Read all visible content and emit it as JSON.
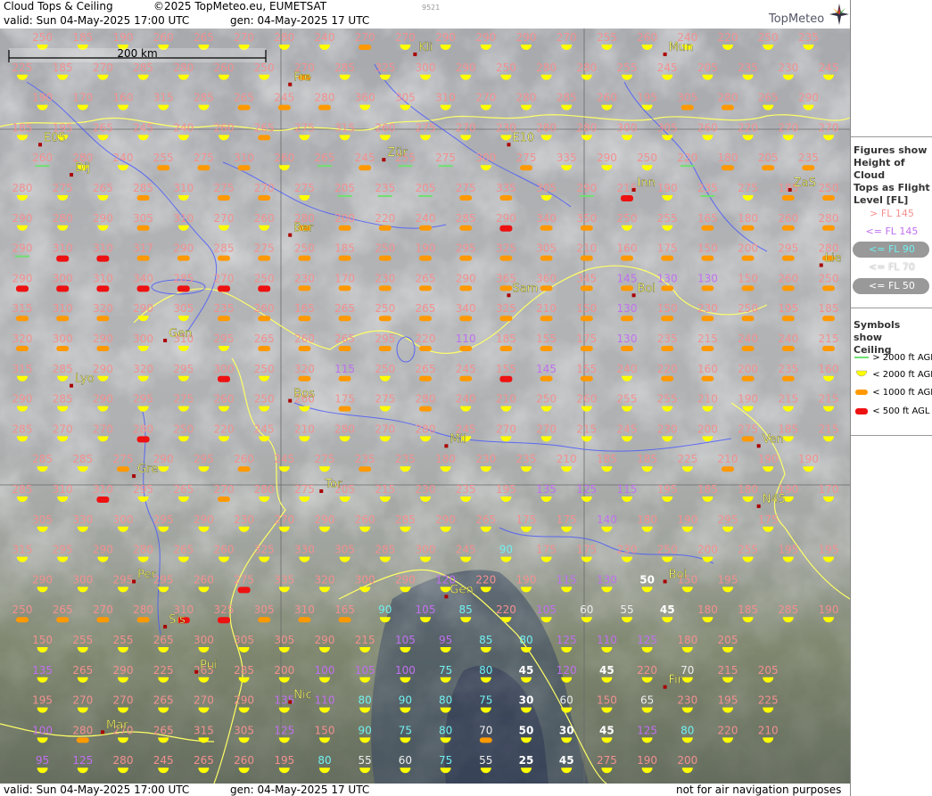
{
  "header": {
    "title": "Cloud Tops & Ceiling",
    "copyright": "©2025 TopMeteo.eu, EUMETSAT",
    "code": "9521",
    "valid": "valid:  Sun  04-May-2025  17:00 UTC",
    "gen": "gen: 04-May-2025 17 UTC",
    "logo": "TopMeteo"
  },
  "footer": {
    "valid": "valid:  Sun  04-May-2025  17:00 UTC",
    "gen": "gen: 04-May-2025 17 UTC",
    "notice": "not for air navigation purposes"
  },
  "scale": {
    "label": "200 km"
  },
  "colors": {
    "fl_above_145": "#f39090",
    "fl_le_145": "#c070f0",
    "fl_le_90": "#70f0f0",
    "fl_le_70": "#eeeeee",
    "fl_le_50": "#ffffff",
    "ceil_gt2000": "#70e070",
    "ceil_lt2000": "#ffff00",
    "ceil_lt1000": "#ff9900",
    "ceil_lt500": "#ee1111",
    "coast": "#ffff66",
    "river": "#3344ff"
  },
  "legend": {
    "figures_title": [
      "Figures show",
      "Height of Cloud",
      "Tops as Flight",
      "Level  [FL]"
    ],
    "fl_items": [
      "> FL 145",
      "<= FL 145",
      "<= FL 90",
      "<= FL 70",
      "<= FL 50"
    ],
    "symbols_title": [
      "Symbols show",
      "Ceiling"
    ],
    "ceiling_items": [
      "> 2000 ft AGL",
      "< 2000 ft AGL",
      "< 1000 ft AGL",
      "< 500 ft AGL"
    ]
  },
  "cities": [
    {
      "name": "Kli",
      "lon": 6,
      "lat": 0.5
    },
    {
      "name": "Mun",
      "lon": 10,
      "lat": 0.5
    },
    {
      "name": "Fre",
      "lon": 4,
      "lat": 1.5
    },
    {
      "name": "E05",
      "lon": 0,
      "lat": 3.5
    },
    {
      "name": "E10",
      "lon": 7.5,
      "lat": 3.5
    },
    {
      "name": "Dij",
      "lon": 0.5,
      "lat": 4.5
    },
    {
      "name": "Zür",
      "lon": 5.5,
      "lat": 4
    },
    {
      "name": "Inn",
      "lon": 9.5,
      "lat": 5
    },
    {
      "name": "ZaS",
      "lon": 12,
      "lat": 5
    },
    {
      "name": "Ber",
      "lon": 4,
      "lat": 6.5
    },
    {
      "name": "Lie",
      "lon": 12.5,
      "lat": 7.5
    },
    {
      "name": "Sam",
      "lon": 7.5,
      "lat": 8.5
    },
    {
      "name": "Bol",
      "lon": 9.5,
      "lat": 8.5
    },
    {
      "name": "Gen",
      "lon": 2,
      "lat": 10
    },
    {
      "name": "Lyo",
      "lon": 0.5,
      "lat": 11.5
    },
    {
      "name": "Bos",
      "lon": 4,
      "lat": 12
    },
    {
      "name": "Mil",
      "lon": 6.5,
      "lat": 13.5
    },
    {
      "name": "Ven",
      "lon": 11.5,
      "lat": 13.5
    },
    {
      "name": "Gre",
      "lon": 1.5,
      "lat": 14.5
    },
    {
      "name": "Tor",
      "lon": 4.5,
      "lat": 15
    },
    {
      "name": "N45",
      "lon": 11.5,
      "lat": 15.5
    },
    {
      "name": "Per",
      "lon": 1.5,
      "lat": 18
    },
    {
      "name": "Gen",
      "lon": 6.5,
      "lat": 18.5
    },
    {
      "name": "Bol",
      "lon": 10,
      "lat": 18
    },
    {
      "name": "Sis",
      "lon": 2,
      "lat": 19.5
    },
    {
      "name": "Pui",
      "lon": 2.5,
      "lat": 21
    },
    {
      "name": "Nic",
      "lon": 4,
      "lat": 22
    },
    {
      "name": "Fir",
      "lon": 10,
      "lat": 21.5
    },
    {
      "name": "Mar",
      "lon": 1,
      "lat": 23
    }
  ],
  "chart_data": {
    "type": "table",
    "description_rows": "Cloud-top flight levels on a 21x25 grid (rows north to south, columns west to east); ceiling class per cell: 0 = >2000 ft AGL, 1 = <2000 ft, 2 = <1000 ft, 3 = <500 ft",
    "fl": [
      [
        250,
        185,
        190,
        260,
        265,
        270,
        280,
        240,
        270,
        270,
        290,
        290,
        290,
        270,
        255,
        260,
        240,
        220,
        250,
        235
      ],
      [
        225,
        185,
        270,
        285,
        280,
        260,
        250,
        270,
        285,
        325,
        300,
        290,
        250,
        280,
        280,
        255,
        245,
        205,
        235,
        230,
        245
      ],
      [
        190,
        170,
        160,
        315,
        285,
        265,
        245,
        280,
        360,
        305,
        310,
        270,
        280,
        285,
        260,
        195,
        305,
        280,
        265,
        290
      ],
      [
        185,
        195,
        265,
        245,
        240,
        260,
        265,
        275,
        315,
        260,
        275,
        270,
        230,
        280,
        280,
        300,
        305,
        260,
        220,
        270,
        270
      ],
      [
        260,
        280,
        240,
        255,
        275,
        310,
        260,
        265,
        245,
        255,
        275,
        300,
        275,
        335,
        290,
        250,
        220,
        180,
        205,
        235
      ],
      [
        280,
        275,
        265,
        285,
        310,
        275,
        270,
        275,
        205,
        235,
        205,
        275,
        335,
        305,
        290,
        215,
        190,
        235,
        275,
        185,
        250
      ],
      [
        290,
        280,
        290,
        305,
        310,
        270,
        260,
        280,
        200,
        220,
        240,
        285,
        290,
        340,
        350,
        250,
        255,
        165,
        180,
        260,
        280
      ],
      [
        290,
        310,
        310,
        317,
        290,
        285,
        275,
        250,
        185,
        250,
        190,
        295,
        325,
        305,
        210,
        160,
        175,
        150,
        200,
        295,
        280
      ],
      [
        290,
        300,
        310,
        340,
        285,
        270,
        250,
        230,
        170,
        230,
        265,
        290,
        365,
        360,
        345,
        145,
        130,
        130,
        150,
        260,
        250
      ],
      [
        315,
        310,
        320,
        290,
        305,
        235,
        260,
        165,
        265,
        250,
        265,
        340,
        325,
        210,
        150,
        130,
        150,
        230,
        250,
        195,
        185
      ],
      [
        320,
        300,
        290,
        300,
        310,
        295,
        265,
        260,
        265,
        295,
        220,
        110,
        185,
        155,
        175,
        130,
        235,
        215,
        240,
        240,
        215
      ],
      [
        315,
        285,
        290,
        320,
        295,
        300,
        250,
        320,
        115,
        250,
        265,
        245,
        155,
        145,
        155,
        240,
        220,
        160,
        200,
        235,
        160
      ],
      [
        290,
        285,
        290,
        295,
        275,
        260,
        250,
        260,
        175,
        275,
        280,
        240,
        210,
        250,
        260,
        255,
        255,
        210,
        190,
        215,
        215
      ],
      [
        285,
        270,
        270,
        280,
        250,
        220,
        245,
        210,
        280,
        270,
        280,
        245,
        270,
        270,
        215,
        245,
        230,
        200,
        275,
        185,
        215
      ],
      [
        285,
        285,
        275,
        290,
        295,
        260,
        245,
        275,
        235,
        235,
        180,
        230,
        235,
        210,
        185,
        185,
        225,
        210,
        190,
        190
      ],
      [
        285,
        310,
        310,
        295,
        265,
        270,
        280,
        275,
        205,
        215,
        230,
        235,
        195,
        135,
        125,
        115,
        195,
        185,
        180,
        190,
        170
      ],
      [
        305,
        330,
        300,
        295,
        290,
        230,
        270,
        290,
        260,
        285,
        290,
        265,
        175,
        175,
        140,
        180,
        190,
        295,
        175
      ],
      [
        315,
        295,
        290,
        280,
        265,
        260,
        325,
        330,
        305,
        285,
        300,
        245,
        90,
        175,
        175,
        230,
        250,
        200,
        255,
        195,
        195
      ],
      [
        290,
        300,
        295,
        295,
        260,
        275,
        335,
        320,
        300,
        290,
        120,
        220,
        190,
        115,
        130,
        50,
        150,
        195
      ],
      [
        250,
        265,
        270,
        280,
        310,
        325,
        305,
        310,
        165,
        90,
        105,
        85,
        220,
        105,
        60,
        55,
        45,
        180,
        185,
        285,
        190
      ],
      [
        150,
        255,
        255,
        265,
        300,
        305,
        305,
        290,
        215,
        105,
        95,
        85,
        80,
        125,
        110,
        125,
        180,
        205
      ],
      [
        135,
        265,
        290,
        225,
        265,
        285,
        200,
        100,
        105,
        100,
        75,
        80,
        45,
        120,
        45,
        220,
        70,
        215,
        205
      ],
      [
        195,
        270,
        270,
        265,
        270,
        290,
        135,
        110,
        80,
        90,
        80,
        75,
        30,
        60,
        150,
        65,
        230,
        195,
        225
      ],
      [
        100,
        280,
        270,
        265,
        315,
        305,
        125,
        150,
        90,
        75,
        80,
        70,
        50,
        30,
        45,
        125,
        80,
        220,
        210
      ],
      [
        95,
        125,
        280,
        245,
        265,
        260,
        195,
        80,
        55,
        60,
        75,
        55,
        25,
        45,
        275,
        190,
        200
      ]
    ],
    "ceiling_row_pattern": [
      [
        1,
        1,
        1,
        1,
        1,
        1,
        1,
        1,
        2,
        1,
        1,
        1,
        1,
        1,
        1,
        1,
        1,
        1,
        1,
        1
      ],
      [
        1,
        1,
        1,
        1,
        1,
        1,
        1,
        2,
        1,
        1,
        1,
        1,
        1,
        1,
        1,
        1,
        1,
        1,
        1,
        1,
        1
      ],
      [
        1,
        1,
        1,
        1,
        1,
        2,
        2,
        2,
        1,
        1,
        1,
        1,
        1,
        1,
        1,
        1,
        2,
        2,
        1,
        1
      ],
      [
        1,
        1,
        1,
        1,
        1,
        1,
        2,
        1,
        1,
        1,
        1,
        1,
        1,
        1,
        1,
        1,
        1,
        1,
        1,
        1,
        1
      ],
      [
        0,
        1,
        1,
        2,
        2,
        2,
        1,
        0,
        2,
        0,
        0,
        1,
        2,
        1,
        1,
        1,
        0,
        2,
        2,
        2
      ],
      [
        1,
        1,
        1,
        2,
        1,
        2,
        2,
        1,
        0,
        0,
        0,
        2,
        2,
        1,
        0,
        3,
        1,
        0,
        1,
        2,
        2
      ],
      [
        1,
        1,
        1,
        2,
        1,
        1,
        1,
        2,
        2,
        2,
        2,
        2,
        3,
        2,
        2,
        1,
        1,
        2,
        2,
        2,
        2
      ],
      [
        0,
        3,
        3,
        2,
        2,
        2,
        2,
        2,
        2,
        2,
        2,
        2,
        2,
        2,
        2,
        2,
        2,
        2,
        2,
        2,
        2
      ],
      [
        3,
        3,
        3,
        3,
        3,
        3,
        3,
        2,
        2,
        2,
        2,
        2,
        2,
        2,
        2,
        2,
        2,
        2,
        2,
        2,
        2
      ],
      [
        2,
        2,
        2,
        1,
        1,
        2,
        2,
        2,
        2,
        2,
        2,
        2,
        2,
        2,
        2,
        2,
        2,
        2,
        2,
        2,
        2
      ],
      [
        2,
        2,
        2,
        1,
        1,
        1,
        2,
        2,
        2,
        2,
        2,
        2,
        2,
        2,
        2,
        2,
        2,
        2,
        2,
        2,
        2
      ],
      [
        1,
        1,
        1,
        1,
        1,
        3,
        1,
        2,
        2,
        1,
        2,
        2,
        3,
        2,
        2,
        1,
        2,
        2,
        2,
        2,
        1
      ],
      [
        1,
        1,
        1,
        1,
        1,
        1,
        1,
        1,
        2,
        1,
        2,
        1,
        1,
        1,
        1,
        1,
        1,
        1,
        1,
        1,
        1
      ],
      [
        1,
        1,
        1,
        3,
        1,
        1,
        1,
        1,
        1,
        1,
        1,
        1,
        1,
        1,
        1,
        1,
        1,
        1,
        2,
        1,
        1
      ],
      [
        1,
        1,
        2,
        1,
        1,
        2,
        1,
        1,
        2,
        1,
        1,
        1,
        1,
        1,
        1,
        1,
        1,
        2,
        1,
        1
      ],
      [
        1,
        1,
        3,
        1,
        1,
        2,
        1,
        1,
        1,
        1,
        1,
        1,
        1,
        1,
        1,
        1,
        1,
        1,
        1,
        1,
        1
      ],
      [
        1,
        1,
        1,
        1,
        1,
        1,
        1,
        1,
        1,
        1,
        1,
        1,
        1,
        1,
        1,
        1,
        1,
        1,
        1
      ],
      [
        1,
        1,
        1,
        1,
        1,
        1,
        1,
        1,
        1,
        1,
        1,
        1,
        1,
        1,
        1,
        1,
        1,
        1,
        1,
        1,
        1
      ],
      [
        1,
        1,
        1,
        1,
        1,
        3,
        1,
        1,
        1,
        1,
        1,
        1,
        1,
        1,
        1,
        1,
        1,
        1
      ],
      [
        2,
        2,
        2,
        2,
        3,
        3,
        2,
        2,
        2,
        1,
        1,
        1,
        1,
        1,
        1,
        1,
        1,
        1,
        1,
        1,
        1
      ],
      [
        1,
        1,
        1,
        1,
        1,
        1,
        1,
        1,
        1,
        1,
        1,
        1,
        1,
        1,
        1,
        1,
        1,
        1
      ],
      [
        1,
        1,
        1,
        1,
        1,
        1,
        1,
        1,
        1,
        1,
        1,
        1,
        1,
        1,
        1,
        1,
        1,
        1,
        1
      ],
      [
        1,
        1,
        1,
        1,
        1,
        1,
        1,
        1,
        1,
        1,
        1,
        1,
        1,
        1,
        1,
        1,
        1,
        1,
        1
      ],
      [
        1,
        2,
        1,
        1,
        1,
        1,
        1,
        1,
        1,
        1,
        1,
        2,
        1,
        1,
        1,
        1,
        1,
        1,
        1
      ],
      [
        1,
        1,
        1,
        1,
        1,
        1,
        1,
        1,
        1,
        1,
        1,
        1,
        1,
        1,
        1,
        1,
        1
      ]
    ]
  }
}
